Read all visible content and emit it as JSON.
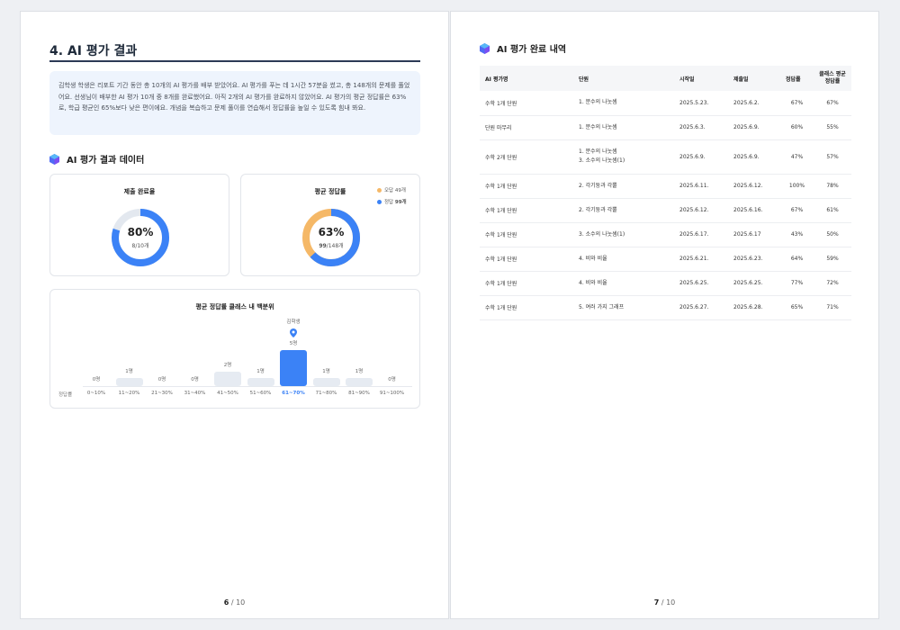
{
  "left_page": {
    "section_title": "4. AI 평가 결과",
    "summary": "김학생 학생은 리포트 기간 동안 총 10개의 AI 평가를 배부 받았어요. AI 평가를 푸는 데 1시간 57분을 썼고, 총 148개의 문제를 풀었어요. 선생님이 배부한 AI 평가 10개 중 8개를 완료했어요. 아직 2개의 AI 평가를 완료하지 않았어요. AI 평가의 평균 정답률은 63%로, 학급 평균인 65%보다 낮은 편이에요. 개념을 복습하고 문제 풀이를 연습해서 정답률을 높일 수 있도록 힘내 봐요.",
    "data_heading": "AI 평가 결과 데이터",
    "completion_card": {
      "title": "제출 완료율",
      "percent_text": "80%",
      "detail": "8/10개",
      "fraction": 0.8
    },
    "accuracy_card": {
      "title": "평균 정답률",
      "percent_text": "63%",
      "detail_bold": "99",
      "detail_rest": "/148개",
      "legend_wrong_label": "오답",
      "legend_wrong_value": "49개",
      "legend_correct_label": "정답",
      "legend_correct_value": "99개",
      "fraction": 0.63
    },
    "distribution": {
      "title": "평균 정답률 클래스 내 백분위",
      "y_label": "정답률",
      "marker_label": "김학생",
      "bins": [
        {
          "range": "0~10%",
          "count": 0,
          "label": "0명"
        },
        {
          "range": "11~20%",
          "count": 1,
          "label": "1명"
        },
        {
          "range": "21~30%",
          "count": 0,
          "label": "0명"
        },
        {
          "range": "31~40%",
          "count": 0,
          "label": "0명"
        },
        {
          "range": "41~50%",
          "count": 2,
          "label": "2명"
        },
        {
          "range": "51~60%",
          "count": 1,
          "label": "1명"
        },
        {
          "range": "61~70%",
          "count": 5,
          "label": "5명",
          "highlight": true
        },
        {
          "range": "71~80%",
          "count": 1,
          "label": "1명"
        },
        {
          "range": "81~90%",
          "count": 1,
          "label": "1명"
        },
        {
          "range": "91~100%",
          "count": 0,
          "label": "0명"
        }
      ]
    },
    "page_current": "6",
    "page_total": " / 10"
  },
  "right_page": {
    "heading": "AI 평가 완료 내역",
    "columns": [
      "AI 평가명",
      "단원",
      "시작일",
      "제출일",
      "정답률",
      "클래스 평균 정답률"
    ],
    "rows": [
      {
        "name": "수학 1개 단원",
        "units": [
          "1. 분수의 나눗셈"
        ],
        "start": "2025.5.23.",
        "submit": "2025.6.2.",
        "rate": "67%",
        "class_avg": "67%"
      },
      {
        "name": "단원 마무리",
        "units": [
          "1. 분수의 나눗셈"
        ],
        "start": "2025.6.3.",
        "submit": "2025.6.9.",
        "rate": "60%",
        "class_avg": "55%"
      },
      {
        "name": "수학 2개 단원",
        "units": [
          "1. 분수의 나눗셈",
          "3. 소수의 나눗셈(1)"
        ],
        "start": "2025.6.9.",
        "submit": "2025.6.9.",
        "rate": "47%",
        "class_avg": "57%"
      },
      {
        "name": "수학 1개 단원",
        "units": [
          "2. 각기둥과 각뿔"
        ],
        "start": "2025.6.11.",
        "submit": "2025.6.12.",
        "rate": "100%",
        "class_avg": "78%"
      },
      {
        "name": "수학 1개 단원",
        "units": [
          "2. 각기둥과 각뿔"
        ],
        "start": "2025.6.12.",
        "submit": "2025.6.16.",
        "rate": "67%",
        "class_avg": "61%"
      },
      {
        "name": "수학 1개 단원",
        "units": [
          "3. 소수의 나눗셈(1)"
        ],
        "start": "2025.6.17.",
        "submit": "2025.6.17",
        "rate": "43%",
        "class_avg": "50%"
      },
      {
        "name": "수학 1개 단원",
        "units": [
          "4. 비와 비율"
        ],
        "start": "2025.6.21.",
        "submit": "2025.6.23.",
        "rate": "64%",
        "class_avg": "59%"
      },
      {
        "name": "수학 1개 단원",
        "units": [
          "4. 비와 비율"
        ],
        "start": "2025.6.25.",
        "submit": "2025.6.25.",
        "rate": "77%",
        "class_avg": "72%"
      },
      {
        "name": "수학 1개 단원",
        "units": [
          "5. 여러 가지 그래프"
        ],
        "start": "2025.6.27.",
        "submit": "2025.6.28.",
        "rate": "65%",
        "class_avg": "71%"
      }
    ],
    "page_current": "7",
    "page_total": " / 10"
  },
  "colors": {
    "primary": "#3b82f6",
    "wrong": "#f5b867",
    "ring_bg": "#e3e8ef",
    "summary_bg": "#eef4fd"
  },
  "chart_data": {
    "type": "bar",
    "title": "평균 정답률 클래스 내 백분위",
    "categories": [
      "0~10%",
      "11~20%",
      "21~30%",
      "31~40%",
      "41~50%",
      "51~60%",
      "61~70%",
      "71~80%",
      "81~90%",
      "91~100%"
    ],
    "values": [
      0,
      1,
      0,
      0,
      2,
      1,
      5,
      1,
      1,
      0
    ],
    "xlabel": "정답률",
    "ylabel": "",
    "highlight_category": "61~70%",
    "highlight_label": "김학생"
  }
}
